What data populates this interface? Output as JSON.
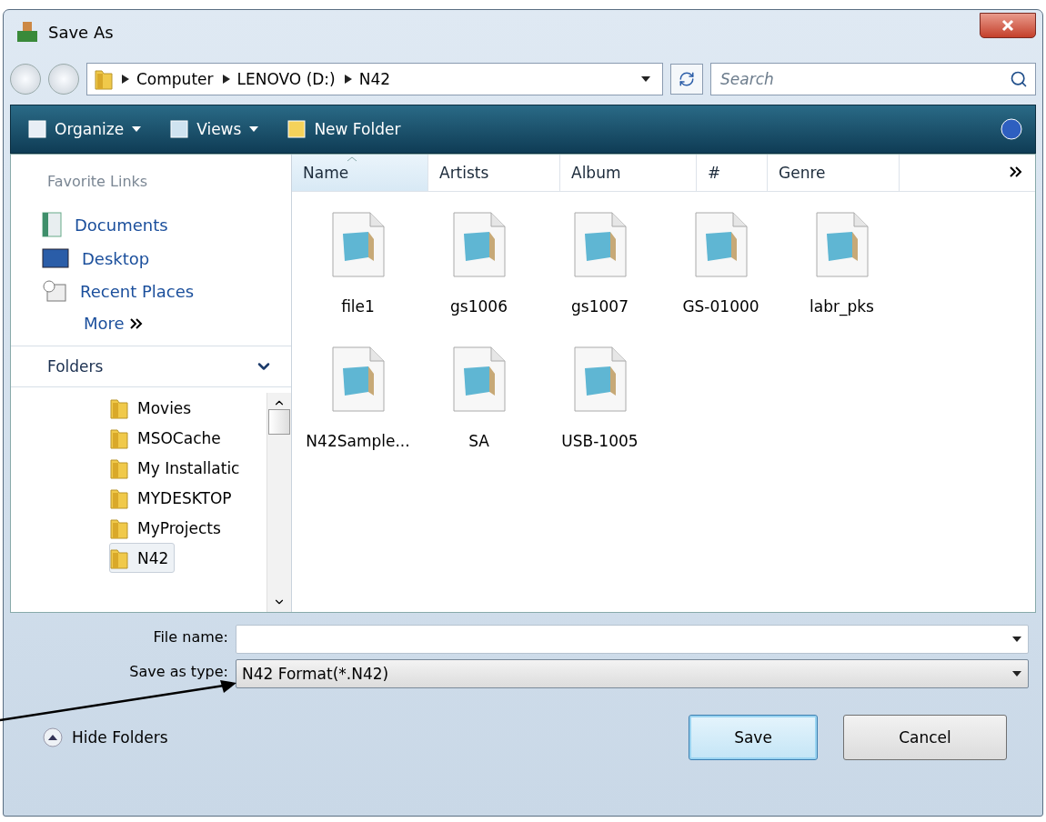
{
  "window": {
    "title": "Save As"
  },
  "address": {
    "path": [
      "Computer",
      "LENOVO (D:)",
      "N42"
    ]
  },
  "search": {
    "placeholder": "Search"
  },
  "toolbar": {
    "items": [
      "Organize",
      "Views",
      "New Folder"
    ]
  },
  "sidebar": {
    "favorites_heading": "Favorite Links",
    "links": [
      {
        "label": "Documents",
        "kind": "documents"
      },
      {
        "label": "Desktop",
        "kind": "desktop"
      },
      {
        "label": "Recent Places",
        "kind": "recent"
      }
    ],
    "more": "More",
    "folders_heading": "Folders",
    "folders": [
      {
        "label": "Movies",
        "selected": false
      },
      {
        "label": "MSOCache",
        "selected": false
      },
      {
        "label": "My Installatic",
        "selected": false
      },
      {
        "label": "MYDESKTOP",
        "selected": false
      },
      {
        "label": "MyProjects",
        "selected": false
      },
      {
        "label": "N42",
        "selected": true
      }
    ]
  },
  "columns": [
    {
      "label": "Name",
      "sorted": true
    },
    {
      "label": "Artists",
      "sorted": false
    },
    {
      "label": "Album",
      "sorted": false
    },
    {
      "label": "#",
      "sorted": false
    },
    {
      "label": "Genre",
      "sorted": false
    }
  ],
  "files": [
    {
      "name": "file1"
    },
    {
      "name": "gs1006"
    },
    {
      "name": "gs1007"
    },
    {
      "name": "GS-01000"
    },
    {
      "name": "labr_pks"
    },
    {
      "name": "N42Sample..."
    },
    {
      "name": "SA"
    },
    {
      "name": "USB-1005"
    }
  ],
  "file_name": {
    "label": "File name:"
  },
  "save_as_type": {
    "label": "Save as type:",
    "value": "N42 Format(*.N42)"
  },
  "hide_folders": "Hide Folders",
  "buttons": [
    {
      "label": "Save",
      "default": true
    },
    {
      "label": "Cancel",
      "default": false
    }
  ]
}
